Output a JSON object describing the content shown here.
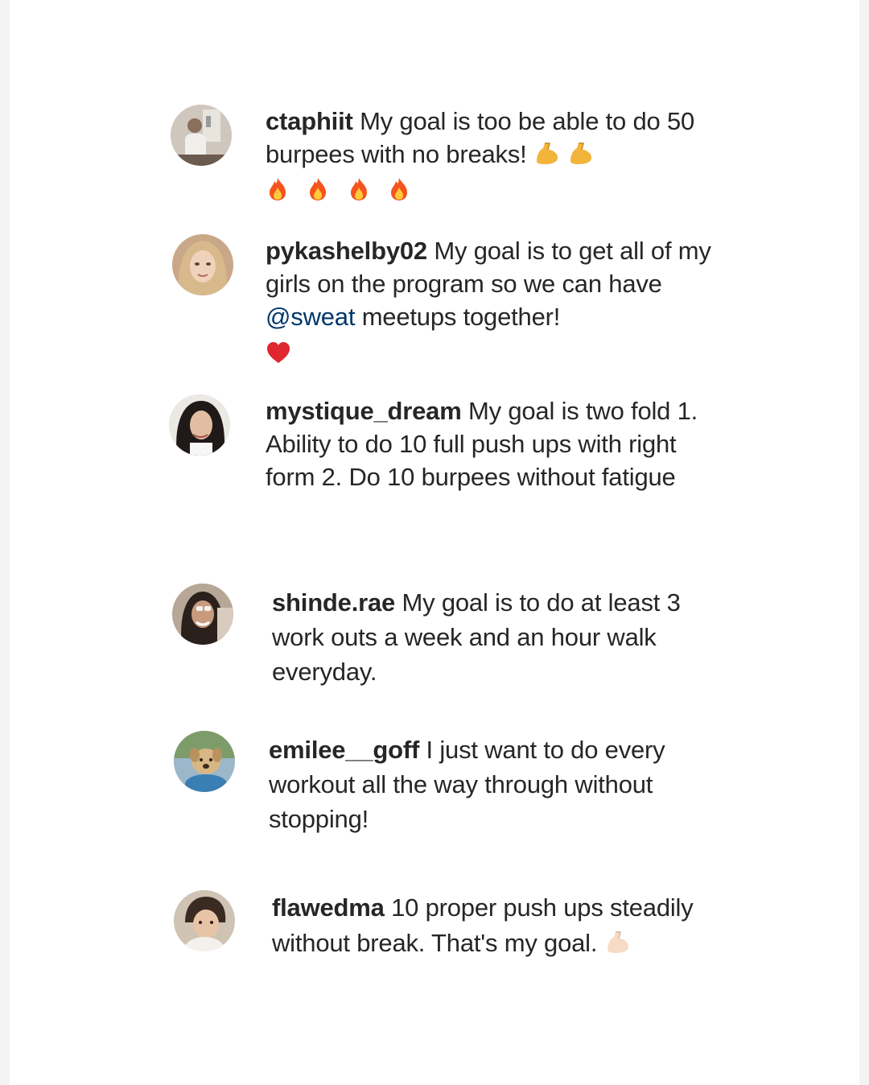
{
  "comments": [
    {
      "username": "ctaphiit",
      "text": "My goal is too be able to do 50 burpees with no breaks!",
      "emojis_inline": [
        "flexed-biceps",
        "flexed-biceps"
      ],
      "emojis_row": [
        "fire",
        "fire",
        "fire",
        "fire"
      ]
    },
    {
      "username": "pykashelby02",
      "text_before": "My goal is to get all of my girls on the program so we can have",
      "mention": "@sweat",
      "text_after": "meetups together!",
      "emojis_row": [
        "red-heart"
      ]
    },
    {
      "username": "mystique_dream",
      "text": "My goal is two fold 1. Ability to do 10 full push ups with right form 2. Do 10 burpees without fatigue"
    },
    {
      "username": "shinde.rae",
      "text": "My goal is to do at least 3 work outs a week and an hour walk everyday."
    },
    {
      "username": "emilee__goff",
      "text": "I just want to do every workout all the way through without stopping!"
    },
    {
      "username": "flawedma",
      "text": "10 proper push ups steadily without break. That's my goal.",
      "emojis_inline": [
        "flexed-biceps-light"
      ]
    }
  ],
  "colors": {
    "text": "#262626",
    "mention": "#00376b",
    "background": "#ffffff",
    "outer": "#f3f3f3"
  }
}
